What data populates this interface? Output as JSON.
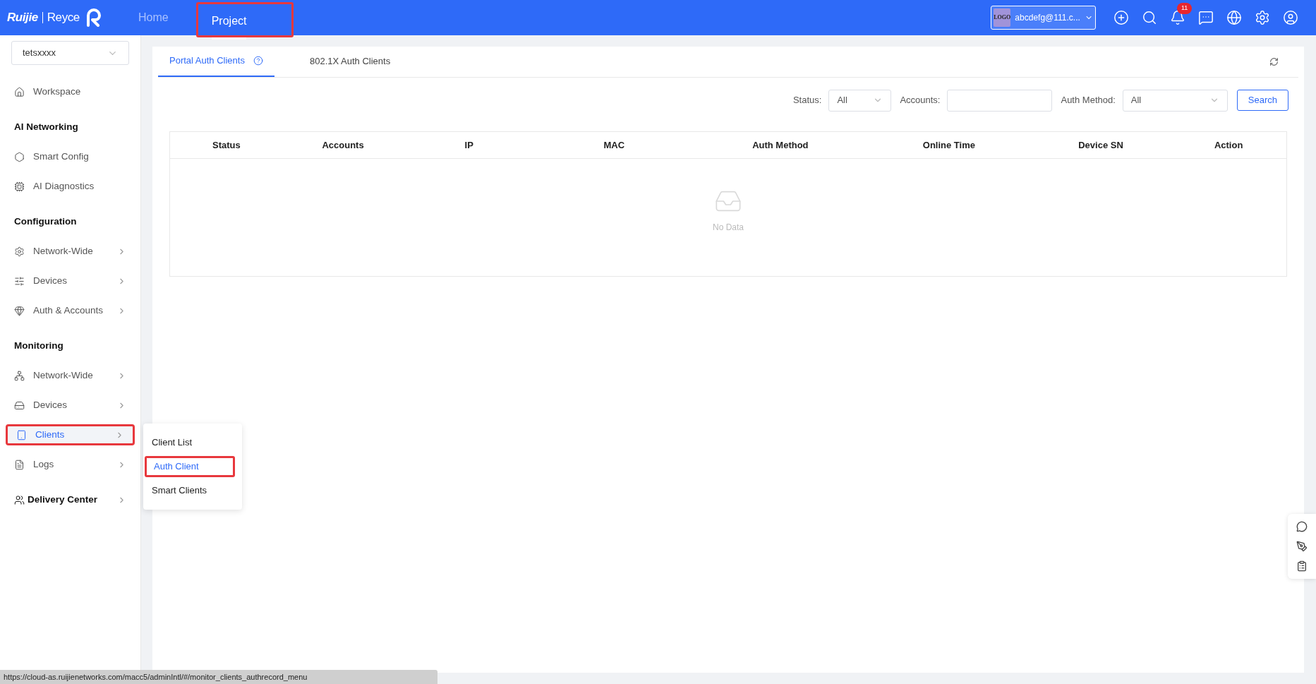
{
  "header": {
    "logo": {
      "brand": "Ruijie",
      "sub_brand": "Reyce"
    },
    "nav": [
      {
        "label": "Home",
        "selected": false,
        "annotated": false
      },
      {
        "label": "Project",
        "selected": true,
        "annotated": true
      }
    ],
    "account": {
      "logo_text": "LOGO",
      "email": "abcdefg@111.c..."
    },
    "notifications": {
      "badge": "11"
    }
  },
  "sidebar": {
    "project_select": {
      "value": "tetsxxxx"
    },
    "items": [
      {
        "kind": "link",
        "label": "Workspace",
        "expandable": false,
        "selected": false,
        "annotated": false
      },
      {
        "kind": "heading",
        "label": "AI Networking"
      },
      {
        "kind": "link",
        "label": "Smart Config",
        "expandable": false,
        "selected": false,
        "annotated": false
      },
      {
        "kind": "link",
        "label": "AI Diagnostics",
        "expandable": false,
        "selected": false,
        "annotated": false
      },
      {
        "kind": "heading",
        "label": "Configuration"
      },
      {
        "kind": "link",
        "label": "Network-Wide",
        "expandable": true,
        "selected": false,
        "annotated": false
      },
      {
        "kind": "link",
        "label": "Devices",
        "expandable": true,
        "selected": false,
        "annotated": false
      },
      {
        "kind": "link",
        "label": "Auth & Accounts",
        "expandable": true,
        "selected": false,
        "annotated": false
      },
      {
        "kind": "heading",
        "label": "Monitoring"
      },
      {
        "kind": "link",
        "label": "Network-Wide",
        "expandable": true,
        "selected": false,
        "annotated": false
      },
      {
        "kind": "link",
        "label": "Devices",
        "expandable": true,
        "selected": false,
        "annotated": false
      },
      {
        "kind": "link",
        "label": "Clients",
        "expandable": true,
        "selected": true,
        "annotated": true
      },
      {
        "kind": "link",
        "label": "Logs",
        "expandable": true,
        "selected": false,
        "annotated": false
      },
      {
        "kind": "section",
        "label": "Delivery Center",
        "expandable": true,
        "selected": false,
        "annotated": false
      }
    ],
    "flyout": [
      {
        "label": "Client List",
        "selected": false,
        "annotated": false
      },
      {
        "label": "Auth Client",
        "selected": true,
        "annotated": true
      },
      {
        "label": "Smart Clients",
        "selected": false,
        "annotated": false
      }
    ]
  },
  "main": {
    "tabs": [
      {
        "label": "Portal Auth Clients",
        "selected": true,
        "help": true
      },
      {
        "label": "802.1X Auth Clients",
        "selected": false,
        "help": false
      }
    ],
    "filters": {
      "status": {
        "label": "Status:",
        "value": "All"
      },
      "accounts": {
        "label": "Accounts:"
      },
      "auth_method": {
        "label": "Auth Method:",
        "value": "All"
      },
      "search_button": "Search"
    },
    "table": {
      "columns": [
        "Status",
        "Accounts",
        "IP",
        "MAC",
        "Auth Method",
        "Online Time",
        "Device SN",
        "Action"
      ],
      "empty_text": "No Data"
    }
  },
  "status_bar": {
    "url": "https://cloud-as.ruijienetworks.com/macc5/adminIntl/#/monitor_clients_authrecord_menu"
  }
}
